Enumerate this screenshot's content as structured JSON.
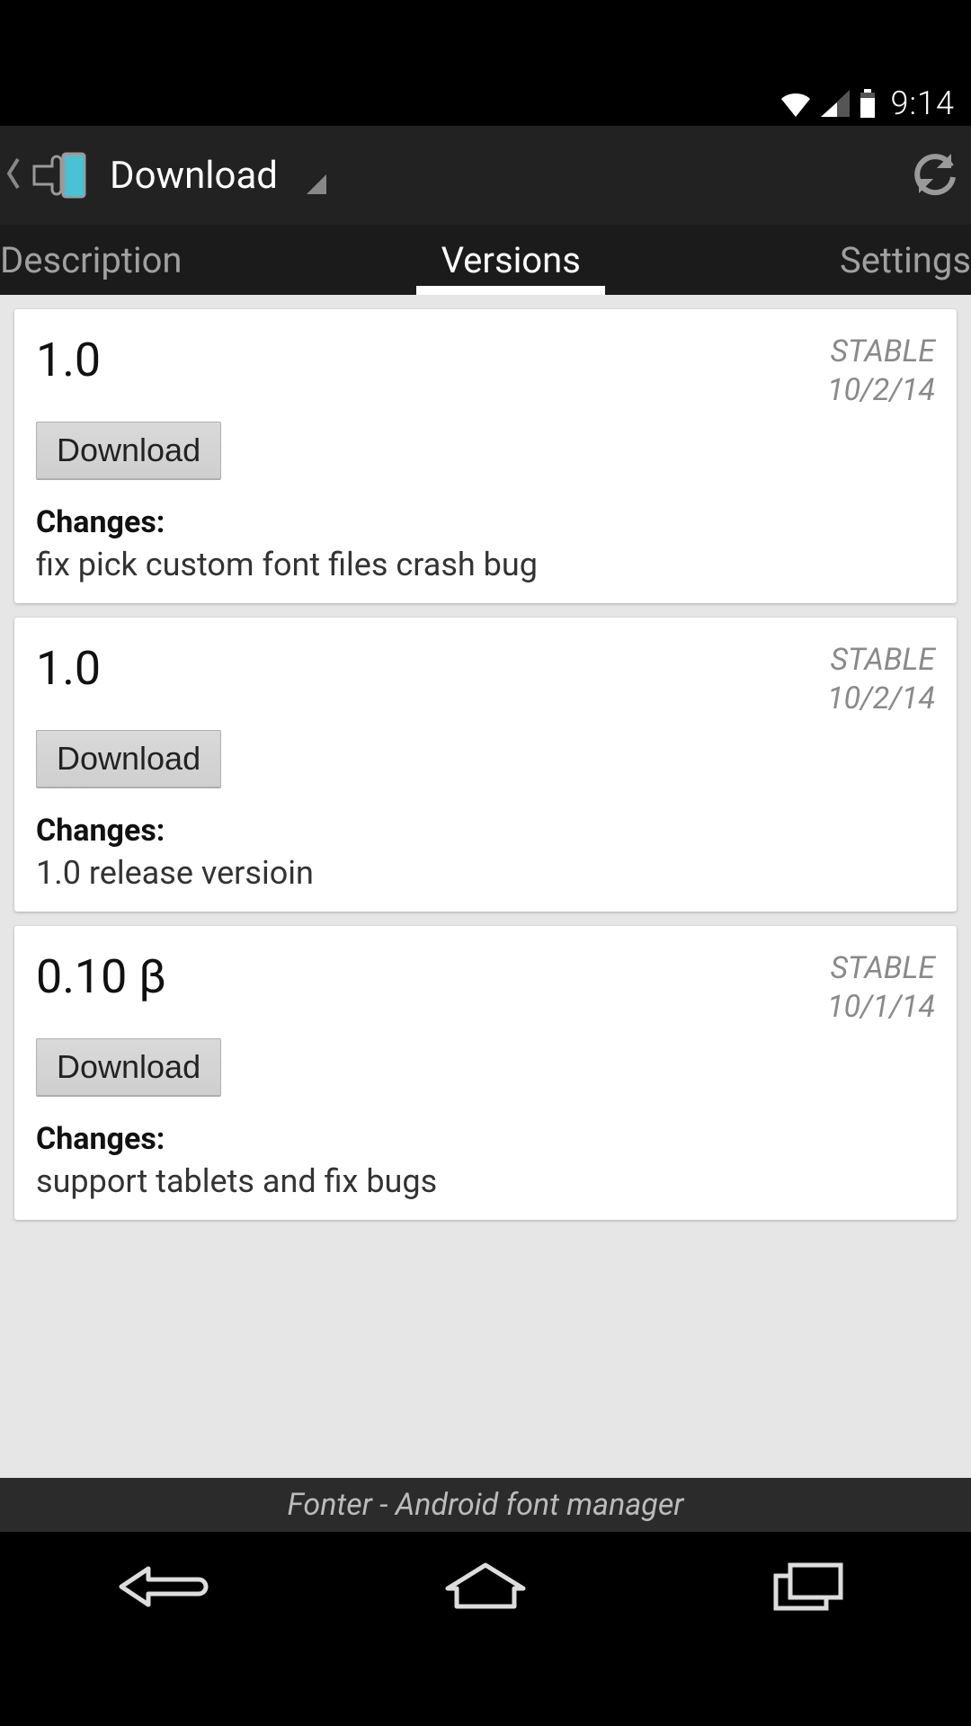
{
  "status_bar": {
    "time": "9:14"
  },
  "action_bar": {
    "title": "Download"
  },
  "tabs": {
    "items": [
      {
        "label": "Description",
        "active": false
      },
      {
        "label": "Versions",
        "active": true
      },
      {
        "label": "Settings",
        "active": false
      }
    ]
  },
  "versions": [
    {
      "name": "1.0",
      "channel": "STABLE",
      "date": "10/2/14",
      "download_label": "Download",
      "changes_label": "Changes:",
      "changes": "fix pick custom font files crash bug"
    },
    {
      "name": "1.0",
      "channel": "STABLE",
      "date": "10/2/14",
      "download_label": "Download",
      "changes_label": "Changes:",
      "changes": "1.0 release versioin"
    },
    {
      "name": "0.10 β",
      "channel": "STABLE",
      "date": "10/1/14",
      "download_label": "Download",
      "changes_label": "Changes:",
      "changes": "support tablets and fix bugs"
    }
  ],
  "footer": {
    "label": "Fonter - Android font manager"
  }
}
